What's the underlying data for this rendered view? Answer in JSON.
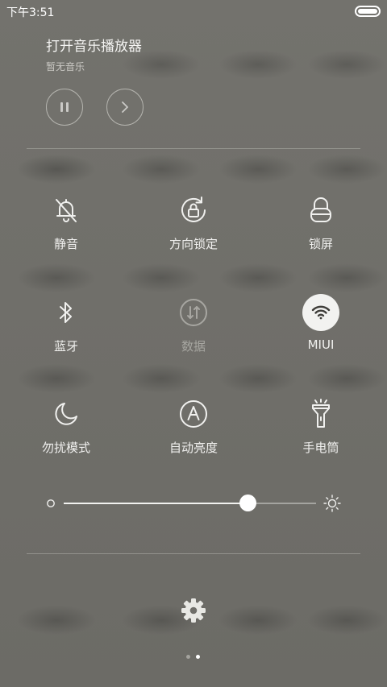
{
  "status_bar": {
    "time": "下午3:51",
    "battery_icon": "battery-icon"
  },
  "music": {
    "title": "打开音乐播放器",
    "subtitle": "暂无音乐",
    "controls": [
      {
        "name": "pause",
        "icon": "pause-icon"
      },
      {
        "name": "next",
        "icon": "chevron-right-icon"
      }
    ]
  },
  "toggles": [
    {
      "label": "静音",
      "icon": "bell-off-icon",
      "active": false,
      "enabled": true
    },
    {
      "label": "方向锁定",
      "icon": "rotation-lock-icon",
      "active": false,
      "enabled": true
    },
    {
      "label": "锁屏",
      "icon": "lock-icon",
      "active": false,
      "enabled": true
    },
    {
      "label": "蓝牙",
      "icon": "bluetooth-icon",
      "active": false,
      "enabled": true
    },
    {
      "label": "数据",
      "icon": "mobile-data-icon",
      "active": false,
      "enabled": false
    },
    {
      "label": "MIUI",
      "icon": "wifi-icon",
      "active": true,
      "enabled": true
    },
    {
      "label": "勿扰模式",
      "icon": "moon-icon",
      "active": false,
      "enabled": true
    },
    {
      "label": "自动亮度",
      "icon": "auto-brightness-icon",
      "active": false,
      "enabled": true
    },
    {
      "label": "手电筒",
      "icon": "flashlight-icon",
      "active": false,
      "enabled": true
    }
  ],
  "brightness": {
    "value": 0.73,
    "min_icon": "brightness-low-icon",
    "max_icon": "brightness-high-icon"
  },
  "settings": {
    "icon": "gear-icon"
  },
  "pager": {
    "pages": 2,
    "current": 1
  },
  "colors": {
    "background": "#6f6e69",
    "text": "#f0f0ee",
    "accent_active": "#f2f2f0",
    "disabled_text": "#a7a6a1"
  }
}
